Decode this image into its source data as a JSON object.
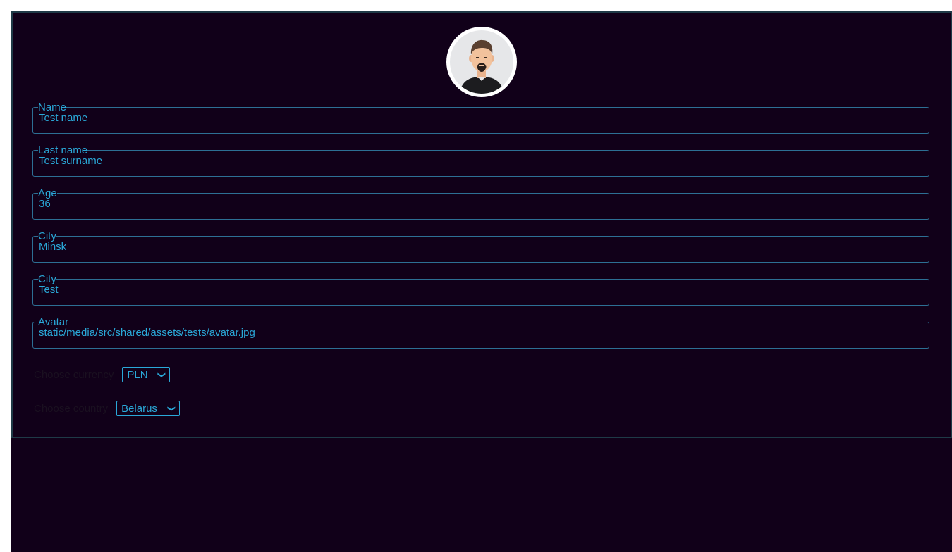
{
  "profile": {
    "avatar_alt": "avatar",
    "fields": [
      {
        "label": "Name",
        "value": "Test name"
      },
      {
        "label": "Last name",
        "value": "Test surname"
      },
      {
        "label": "Age",
        "value": "36"
      },
      {
        "label": "City",
        "value": "Minsk"
      },
      {
        "label": "City",
        "value": "Test"
      },
      {
        "label": "Avatar",
        "value": "static/media/src/shared/assets/tests/avatar.jpg"
      }
    ],
    "currency": {
      "label": "Choose currency",
      "selected": "PLN"
    },
    "country": {
      "label": "Choose country",
      "selected": "Belarus"
    }
  },
  "colors": {
    "background": "#110019",
    "accent": "#2aa8d8",
    "border": "#2d6f94"
  }
}
